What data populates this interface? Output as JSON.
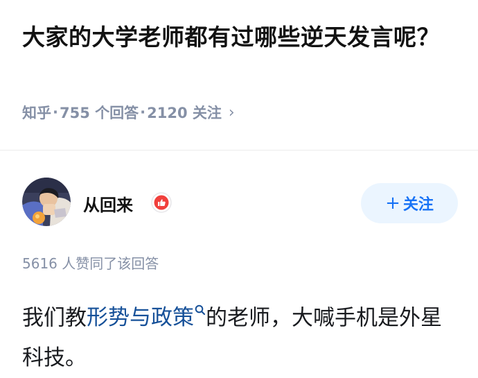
{
  "question": {
    "title": "大家的大学老师都有过哪些逆天发言呢？",
    "site": "知乎",
    "sep": "·",
    "answers": "755 个回答",
    "followers": "2120 关注",
    "chevron": "›"
  },
  "author": {
    "name": "从回来",
    "avatar": "avatar",
    "badge": "thumbs-up-badge-icon"
  },
  "follow_button": {
    "plus": "+",
    "label": "关注"
  },
  "answer": {
    "votes": "5616 人赞同了该回答",
    "text_before": "我们教",
    "link_text": "形势与政策",
    "text_after": "的老师，大喊手机是外星科技。"
  },
  "colors": {
    "accent": "#1772f6",
    "link": "#175199",
    "meta": "#8590a6",
    "badge": "#f1403c"
  }
}
